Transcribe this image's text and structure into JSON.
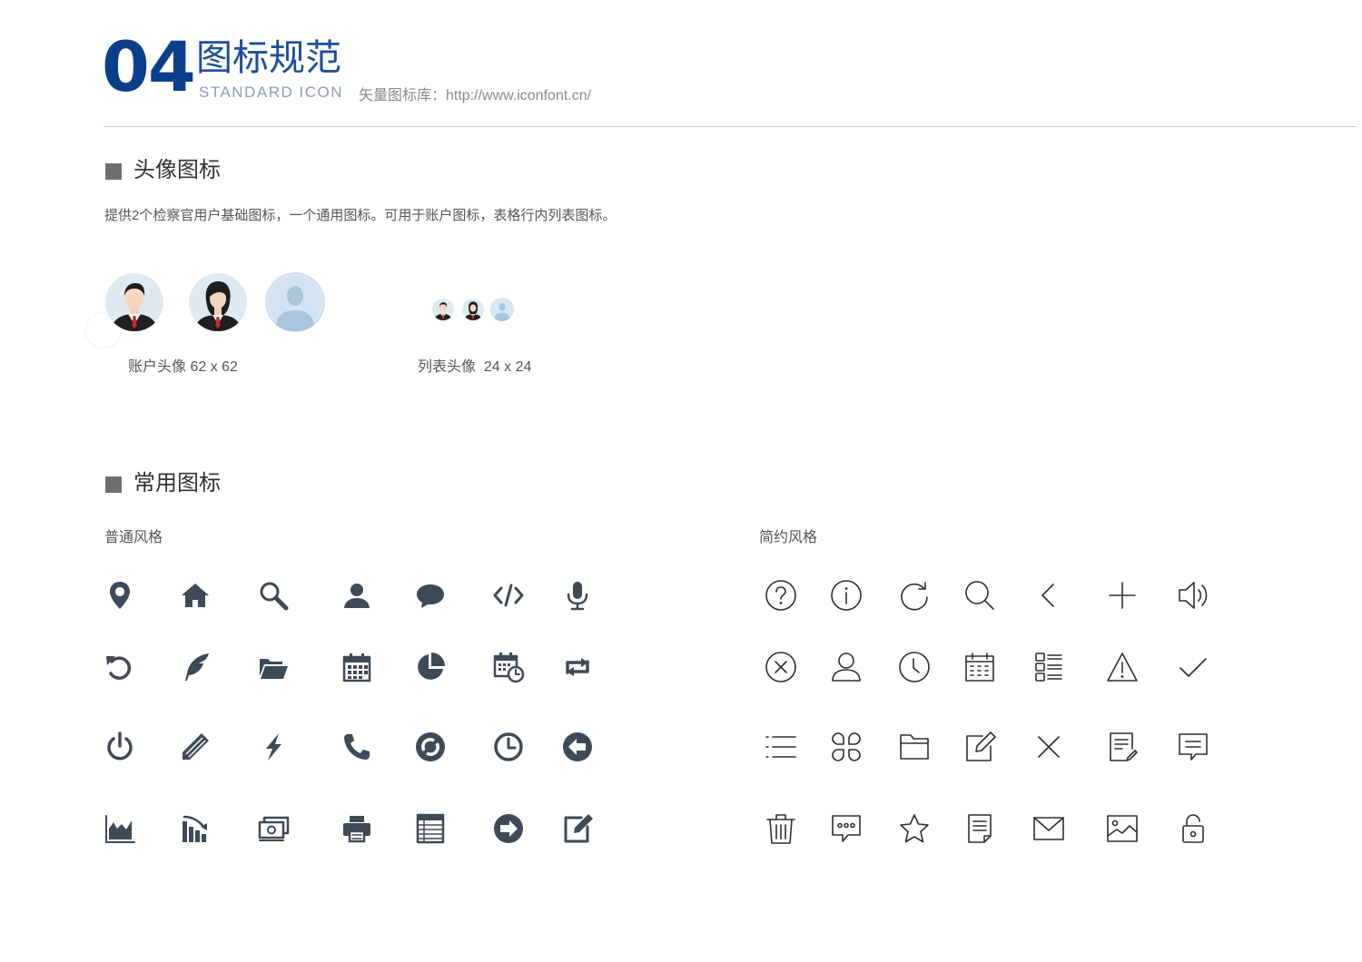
{
  "header": {
    "number": "04",
    "title_cn": "图标规范",
    "title_en": "STANDARD ICON",
    "library_note": "矢量图标库：http://www.iconfont.cn/"
  },
  "avatar_section": {
    "title": "头像图标",
    "description": "提供2个检察官用户基础图标，一个通用图标。可用于账户图标，表格行内列表图标。",
    "account_caption": "账户头像 62 x 62",
    "list_caption": "列表头像  24 x 24",
    "avatars": [
      "male-prosecutor-avatar",
      "female-prosecutor-avatar",
      "generic-user-avatar"
    ]
  },
  "common_section": {
    "title": "常用图标",
    "normal_style_label": "普通风格",
    "simple_style_label": "简约风格",
    "normal_icons": [
      [
        "location-pin-icon",
        "home-icon",
        "search-icon",
        "user-icon",
        "chat-bubble-icon",
        "code-icon",
        "microphone-icon"
      ],
      [
        "undo-icon",
        "feather-icon",
        "folder-open-icon",
        "calendar-icon",
        "pie-chart-icon",
        "calendar-clock-icon",
        "retweet-icon"
      ],
      [
        "power-icon",
        "pencil-icon",
        "lightning-icon",
        "phone-icon",
        "refresh-circle-icon",
        "clock-icon",
        "arrow-left-circle-icon"
      ],
      [
        "area-chart-icon",
        "bar-chart-decline-icon",
        "money-icon",
        "printer-icon",
        "table-icon",
        "arrow-right-circle-icon",
        "edit-icon"
      ]
    ],
    "simple_icons": [
      [
        "question-icon",
        "info-icon",
        "refresh-icon",
        "search-icon",
        "chevron-left-icon",
        "plus-icon",
        "volume-icon"
      ],
      [
        "close-circle-icon",
        "user-icon",
        "clock-icon",
        "calendar-icon",
        "list-grid-icon",
        "warning-icon",
        "check-icon"
      ],
      [
        "list-icon",
        "apps-icon",
        "folder-icon",
        "edit-icon",
        "close-icon",
        "document-edit-icon",
        "message-icon"
      ],
      [
        "trash-icon",
        "comment-more-icon",
        "star-icon",
        "document-icon",
        "mail-icon",
        "image-icon",
        "lock-icon"
      ]
    ]
  },
  "colors": {
    "brand_blue": "#0b3f8c",
    "title_blue": "#1c4f9a",
    "icon_solid": "#3e4a57",
    "icon_line": "#2f2f2f",
    "marker_gray": "#6f6f6f"
  }
}
